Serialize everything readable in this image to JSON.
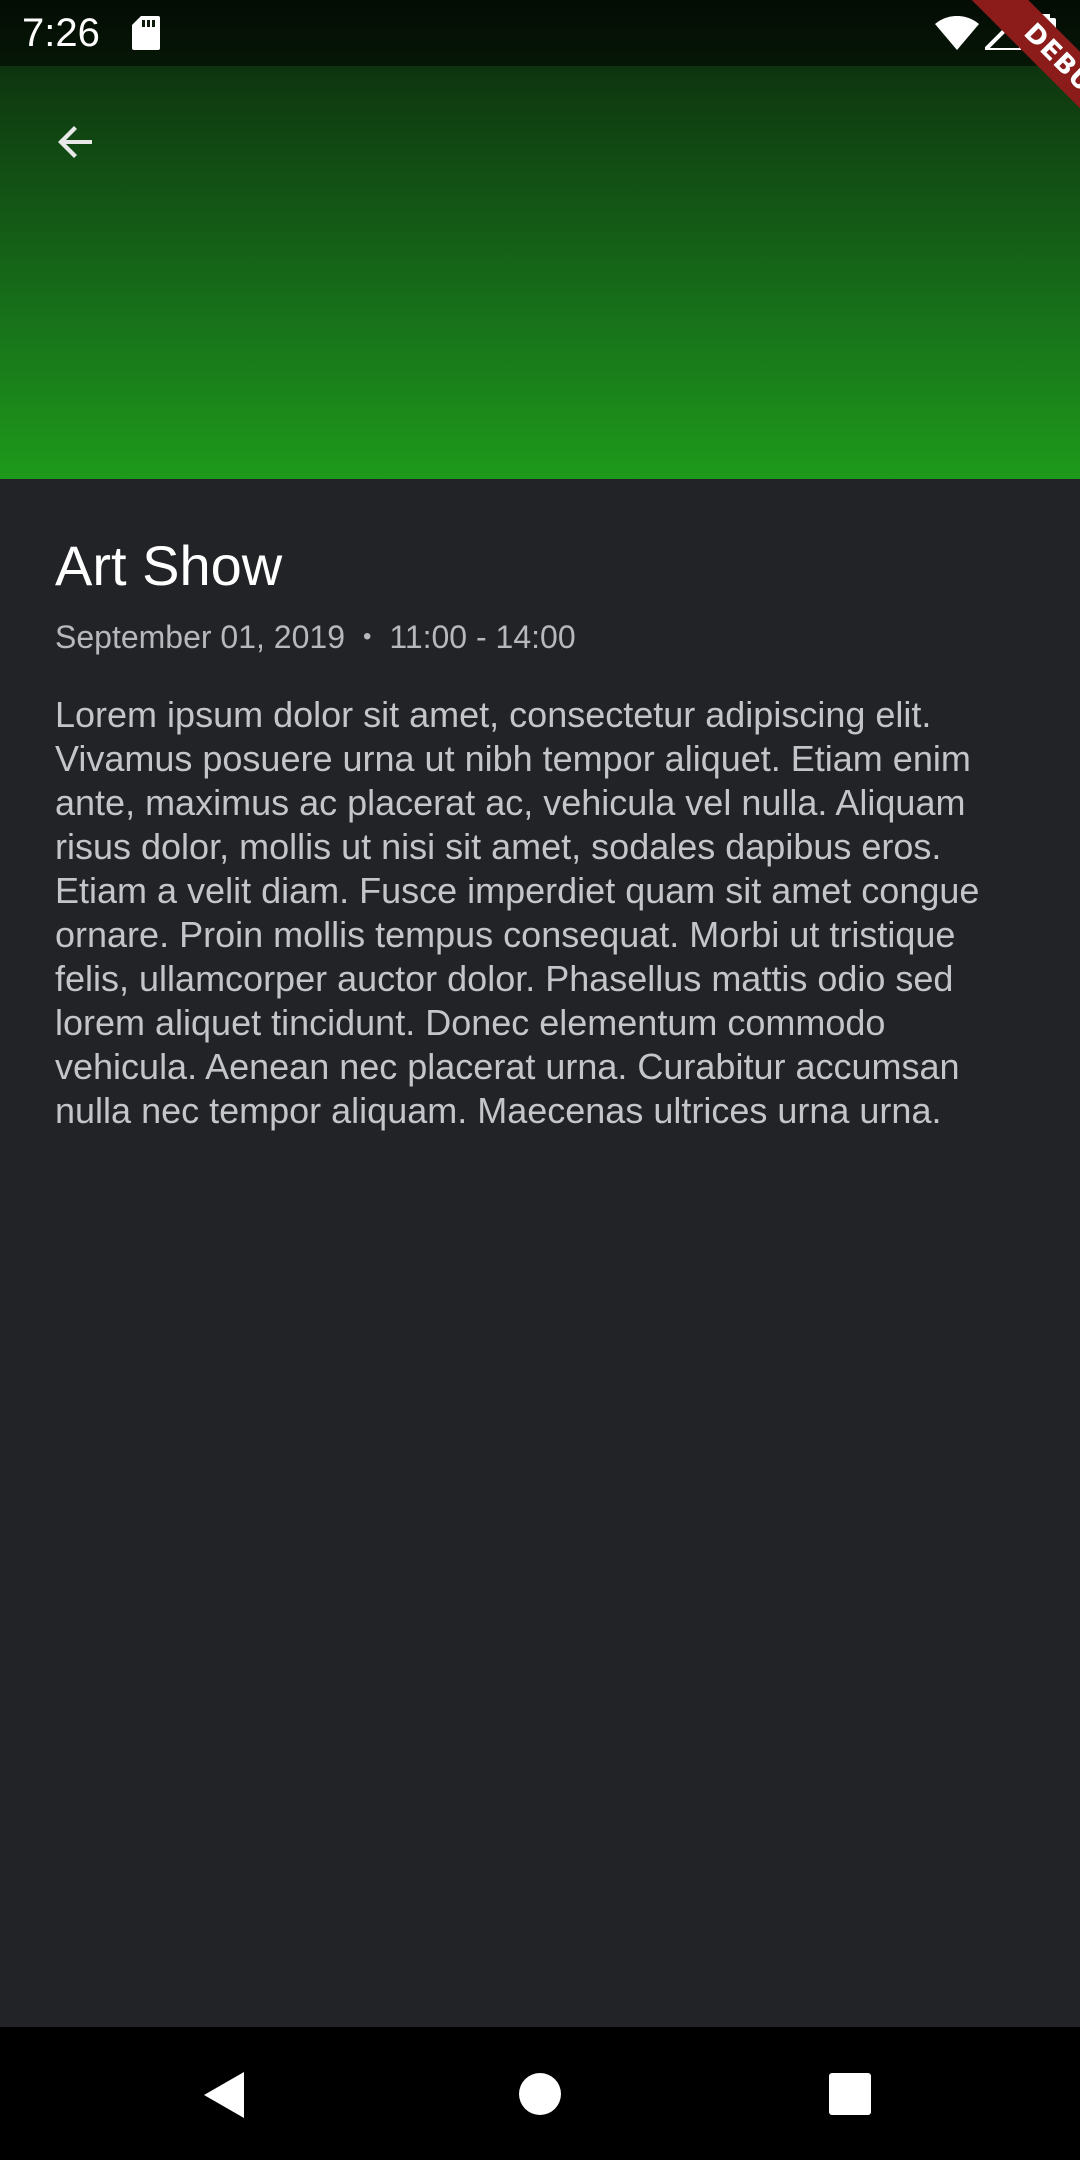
{
  "status_bar": {
    "time": "7:26",
    "icons": [
      "sd-card-icon",
      "wifi-icon",
      "signal-icon",
      "battery-icon"
    ]
  },
  "debug_banner": {
    "label": "DEBUG"
  },
  "header": {
    "back_icon": "arrow-back-icon",
    "gradient_colors": [
      "#0b1c0b",
      "#1e9a1b"
    ]
  },
  "event": {
    "title": "Art Show",
    "date": "September 01, 2019",
    "separator": "•",
    "time_range": "11:00 - 14:00",
    "description": "Lorem ipsum dolor sit amet, consectetur adipiscing elit. Vivamus posuere urna ut nibh tempor aliquet. Etiam enim ante, maximus ac placerat ac, vehicula vel nulla. Aliquam risus dolor, mollis ut nisi sit amet, sodales dapibus eros. Etiam a velit diam. Fusce imperdiet quam sit amet congue ornare. Proin mollis tempus consequat. Morbi ut tristique felis, ullamcorper auctor dolor. Phasellus mattis odio sed lorem aliquet tincidunt. Donec elementum commodo vehicula. Aenean nec placerat urna. Curabitur accumsan nulla nec tempor aliquam. Maecenas ultrices urna urna."
  },
  "nav_bar": {
    "icons": [
      "nav-back-icon",
      "nav-home-icon",
      "nav-recents-icon"
    ]
  },
  "colors": {
    "background": "#222327",
    "title": "#ffffff",
    "meta": "#b7b8bb",
    "body_text": "#c4c5c8",
    "debug_ribbon": "#8b1c1a"
  }
}
